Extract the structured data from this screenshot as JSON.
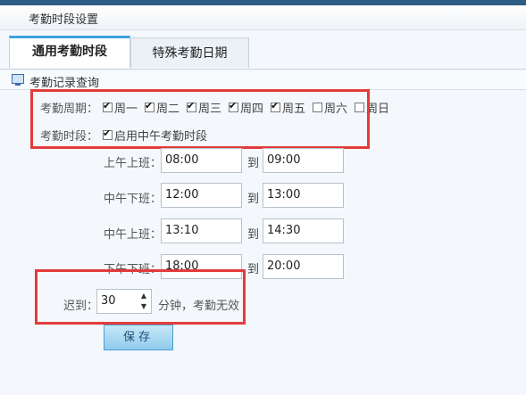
{
  "window": {
    "title": "考勤时段设置"
  },
  "tabs": [
    {
      "label": "通用考勤时段",
      "active": true
    },
    {
      "label": "特殊考勤日期",
      "active": false
    }
  ],
  "section": {
    "title": "考勤记录查询"
  },
  "week": {
    "label": "考勤周期：",
    "days": [
      {
        "label": "周一",
        "checked": true
      },
      {
        "label": "周二",
        "checked": true
      },
      {
        "label": "周三",
        "checked": true
      },
      {
        "label": "周四",
        "checked": true
      },
      {
        "label": "周五",
        "checked": true
      },
      {
        "label": "周六",
        "checked": false
      },
      {
        "label": "周日",
        "checked": false
      }
    ]
  },
  "period": {
    "label": "考勤时段：",
    "noon_label": "启用中午考勤时段",
    "noon_checked": true
  },
  "times": [
    {
      "label": "上午上班：",
      "start": "08:00",
      "to": "到",
      "end": "09:00"
    },
    {
      "label": "中午下班：",
      "start": "12:00",
      "to": "到",
      "end": "13:00"
    },
    {
      "label": "中午上班：",
      "start": "13:10",
      "to": "到",
      "end": "14:30"
    },
    {
      "label": "下午下班：",
      "start": "18:00",
      "to": "到",
      "end": "20:00"
    }
  ],
  "late": {
    "label": "迟到：",
    "value": "30",
    "suffix": "分钟，考勤无效"
  },
  "save_label": "保存",
  "colors": {
    "highlight": "#e23b3b",
    "tab_accent": "#3da3e0"
  }
}
